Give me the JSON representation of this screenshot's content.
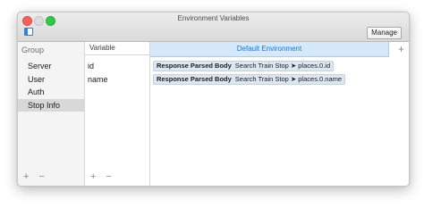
{
  "window": {
    "title": "Environment Variables"
  },
  "toolbar": {
    "manage_label": "Manage"
  },
  "groups": {
    "header": "Group",
    "items": [
      {
        "label": "Server"
      },
      {
        "label": "User"
      },
      {
        "label": "Auth"
      },
      {
        "label": "Stop Info",
        "selected": true
      }
    ],
    "add_label": "+",
    "remove_label": "−"
  },
  "variables": {
    "header": "Variable",
    "items": [
      {
        "name": "id"
      },
      {
        "name": "name"
      }
    ],
    "add_label": "+",
    "remove_label": "−"
  },
  "environment": {
    "header": "Default Environment",
    "add_label": "+",
    "values": [
      {
        "kind": "Response Parsed Body",
        "detail": "Search Train Stop ➤ places.0.id"
      },
      {
        "kind": "Response Parsed Body",
        "detail": "Search Train Stop ➤ places.0.name"
      }
    ]
  },
  "colors": {
    "accent": "#2b82d9",
    "header_bg": "#d5e9fb",
    "selected_row": "#d8d8d8"
  }
}
